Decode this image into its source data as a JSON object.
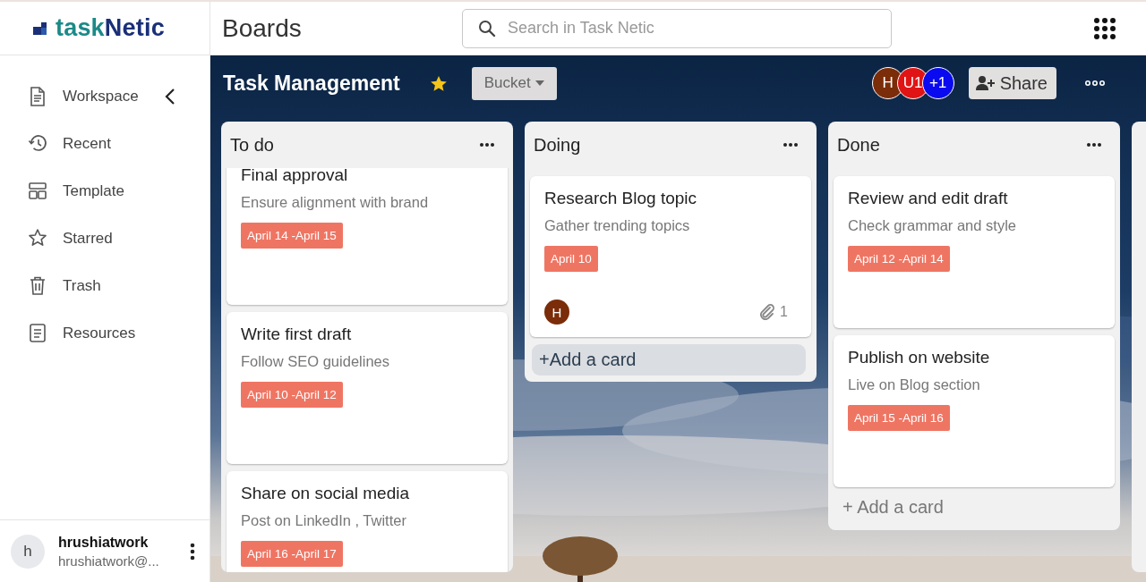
{
  "logo": {
    "text_1": "task",
    "text_2": "Netic"
  },
  "header": {
    "title": "Boards",
    "search": {
      "placeholder": "Search in Task Netic"
    }
  },
  "sidebar": {
    "items": [
      {
        "label": "Workspace"
      },
      {
        "label": "Recent"
      },
      {
        "label": "Template"
      },
      {
        "label": "Starred"
      },
      {
        "label": "Trash"
      },
      {
        "label": "Resources"
      }
    ],
    "user": {
      "initial": "h",
      "name": "hrushiatwork",
      "email": "hrushiatwork@..."
    }
  },
  "board": {
    "title": "Task Management",
    "starred": true,
    "bucket": "Bucket",
    "members": [
      {
        "label": "H",
        "color": "#7b2c08"
      },
      {
        "label": "U1",
        "color": "#e01414"
      },
      {
        "label": "+1",
        "color": "#0a0af0"
      }
    ],
    "share": "Share",
    "lists": [
      {
        "title": "To do",
        "scrolled": true,
        "cards": [
          {
            "title": "Final approval",
            "description": "Ensure alignment with brand",
            "date": "April 14 -April 15"
          },
          {
            "title": "Write first draft",
            "description": "Follow SEO guidelines",
            "date": "April 10 -April 12"
          },
          {
            "title": "Share on social media",
            "description": "Post on LinkedIn , Twitter",
            "date": "April 16 -April 17"
          }
        ]
      },
      {
        "title": "Doing",
        "scrolled": false,
        "cards": [
          {
            "title": "Research Blog topic",
            "description": "Gather trending topics",
            "date": "April 10",
            "assignee": "H",
            "attachments": "1"
          }
        ],
        "add_card": {
          "label": "+Add a card",
          "hovered": true
        }
      },
      {
        "title": "Done",
        "scrolled": false,
        "cards": [
          {
            "title": "Review and edit draft",
            "description": "Check grammar and style",
            "date": "April 12 -April 14"
          },
          {
            "title": "Publish on website",
            "description": "Live on Blog section",
            "date": "April 15 -April 16"
          }
        ],
        "add_card": {
          "label": "+ Add a card",
          "hovered": false
        }
      }
    ]
  }
}
